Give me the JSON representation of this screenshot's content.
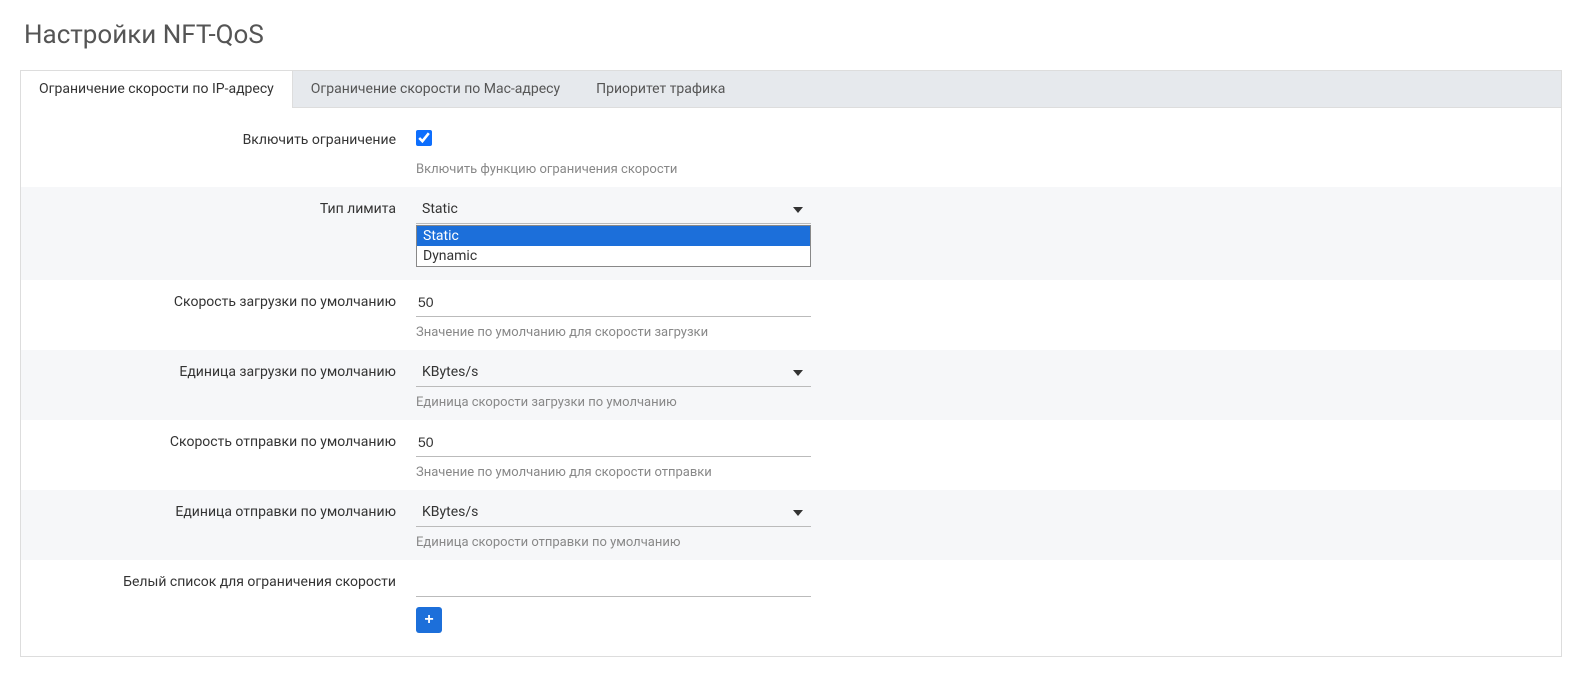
{
  "page": {
    "title": "Настройки NFT-QoS"
  },
  "tabs": {
    "t0": "Ограничение скорости по IP-адресу",
    "t1": "Ограничение скорости по Mac-адресу",
    "t2": "Приоритет трафика"
  },
  "form": {
    "enable": {
      "label": "Включить ограничение",
      "checked": true,
      "help": "Включить функцию ограничения скорости"
    },
    "limit_type": {
      "label": "Тип лимита",
      "value": "Static",
      "options": {
        "o0": "Static",
        "o1": "Dynamic"
      }
    },
    "dl_speed": {
      "label": "Скорость загрузки по умолчанию",
      "value": "50",
      "help": "Значение по умолчанию для скорости загрузки"
    },
    "dl_unit": {
      "label": "Единица загрузки по умолчанию",
      "value": "KBytes/s",
      "help": "Единица скорости загрузки по умолчанию"
    },
    "ul_speed": {
      "label": "Скорость отправки по умолчанию",
      "value": "50",
      "help": "Значение по умолчанию для скорости отправки"
    },
    "ul_unit": {
      "label": "Единица отправки по умолчанию",
      "value": "KBytes/s",
      "help": "Единица скорости отправки по умолчанию"
    },
    "whitelist": {
      "label": "Белый список для ограничения скорости",
      "add_label": "+"
    }
  }
}
